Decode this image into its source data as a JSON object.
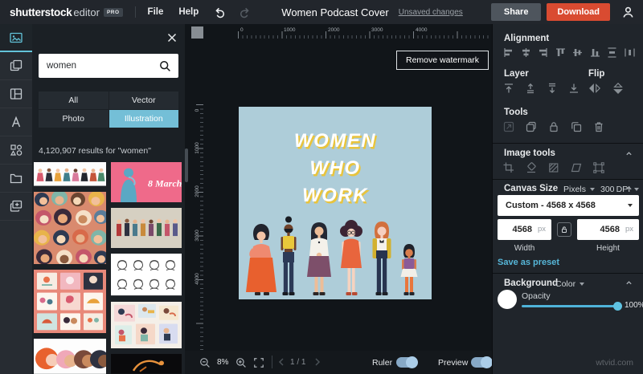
{
  "header": {
    "brand": "shutterstock",
    "product": "editor",
    "badge": "PRO",
    "menu_file": "File",
    "menu_help": "Help",
    "doc_title": "Women Podcast Cover",
    "unsaved": "Unsaved changes",
    "share_label": "Share",
    "download_label": "Download"
  },
  "left_panel": {
    "search_query": "women",
    "filters": {
      "all": "All",
      "vector": "Vector",
      "photo": "Photo",
      "illustration": "Illustration"
    },
    "active_filter": "Illustration",
    "results_text": "4,120,907 results for \"women\"",
    "thumbnails": [
      {
        "desc": "row of diverse women holding hands on white"
      },
      {
        "desc": "8 March women's day pink card with blue silhouette",
        "text": "8 March"
      },
      {
        "desc": "seamless pattern of diverse women faces"
      },
      {
        "desc": "group of professional women standing on beige"
      },
      {
        "desc": "grid of women's day greeting cards on coral"
      },
      {
        "desc": "hand-drawn line sketch women avatars"
      },
      {
        "desc": "overlapping women profile silhouettes"
      },
      {
        "desc": "pastel cards with women illustrations"
      },
      {
        "desc": "golden gymnast figure on black"
      }
    ]
  },
  "canvas": {
    "remove_watermark_label": "Remove watermark",
    "title_line1": "WOMEN",
    "title_line2": "WHO",
    "title_line3": "WORK",
    "h_ruler": [
      "0",
      "1000",
      "2000",
      "3000",
      "4000"
    ],
    "v_ruler": [
      "0",
      "1000",
      "2000",
      "3000",
      "4000"
    ],
    "background_hex": "#aecdd9",
    "title_color": "#ffffff",
    "title_shadow_hex": "#e9c43c"
  },
  "bottom_bar": {
    "zoom_level": "8%",
    "page_indicator": "1 / 1",
    "ruler_label": "Ruler",
    "ruler_on": true,
    "preview_label": "Preview",
    "preview_on": true
  },
  "right_panel": {
    "alignment_title": "Alignment",
    "layer_title": "Layer",
    "flip_title": "Flip",
    "tools_title": "Tools",
    "image_tools_title": "Image tools",
    "canvas_size_title": "Canvas Size",
    "units_value": "Pixels",
    "dpi_value": "300",
    "dpi_suffix": "DPI",
    "preset_value": "Custom - 4568 x 4568",
    "width_value": "4568",
    "height_value": "4568",
    "px_unit": "px",
    "width_label": "Width",
    "height_label": "Height",
    "save_preset_label": "Save as preset",
    "background_title": "Background",
    "background_mode": "Color",
    "opacity_label": "Opacity",
    "opacity_value": "100%"
  },
  "colors": {
    "accent_teal": "#74bfd7",
    "download_red": "#d94b31",
    "toggle_blue": "#87a9c6",
    "slider_teal": "#4fb3d9"
  },
  "watermark_text": "wtvid.com"
}
